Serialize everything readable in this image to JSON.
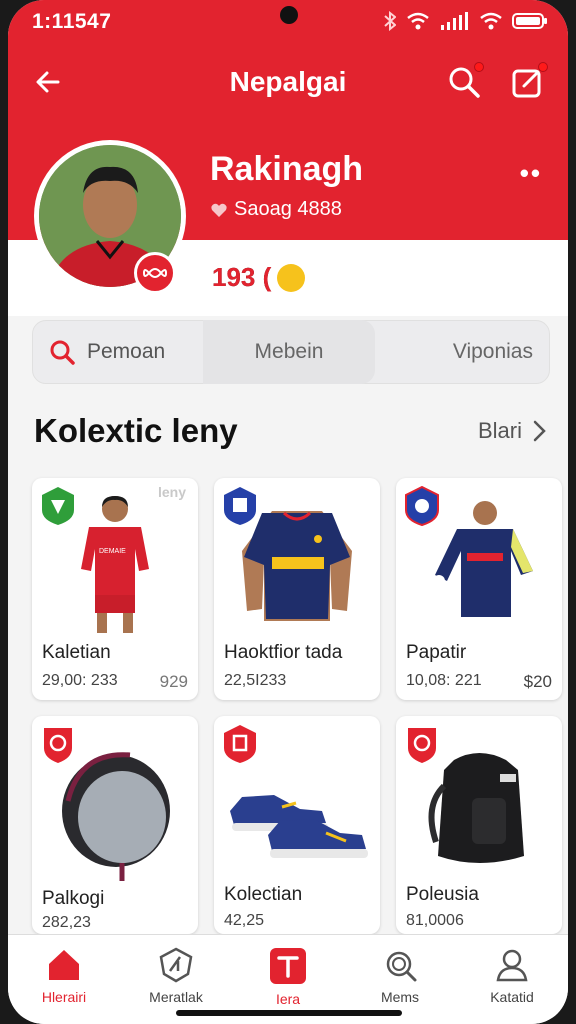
{
  "status": {
    "time": "1:11547"
  },
  "header": {
    "title": "Nepalgai"
  },
  "profile": {
    "name": "Rakinagh",
    "subtitle": "Saoag 4888",
    "points": "193 ("
  },
  "segments": {
    "first": "Pemoan",
    "second": "Mebein",
    "third": "Viponias"
  },
  "section": {
    "title": "Kolextic leny",
    "see_all": "Blari"
  },
  "cards": [
    {
      "name": "Kaletian",
      "meta": "29,00: 233",
      "price": "929",
      "badge_color": "#2f9e3a",
      "tag": "leny"
    },
    {
      "name": "Haoktfior tada",
      "meta": "22,5I233",
      "price": "",
      "badge_color": "#2540a8"
    },
    {
      "name": "Papatir",
      "meta": "10,08: 221",
      "price": "$20",
      "badge_color": "#2540a8"
    },
    {
      "name": "Palkogi",
      "meta": "282,23",
      "price": "",
      "badge_color": "#e2232f"
    },
    {
      "name": "Kolectian",
      "meta": "42,25",
      "price": "",
      "badge_color": "#e2232f"
    },
    {
      "name": "Poleusia",
      "meta": "81,0006",
      "price": "",
      "badge_color": "#e2232f"
    }
  ],
  "nav": [
    {
      "label": "Hlerairi",
      "icon": "home-icon"
    },
    {
      "label": "Meratlak",
      "icon": "shield-icon"
    },
    {
      "label": "Iera",
      "icon": "jersey-icon"
    },
    {
      "label": "Mems",
      "icon": "search-icon"
    },
    {
      "label": "Katatid",
      "icon": "user-icon"
    }
  ],
  "colors": {
    "primary": "#e2232f",
    "background": "#f4f4f4"
  }
}
